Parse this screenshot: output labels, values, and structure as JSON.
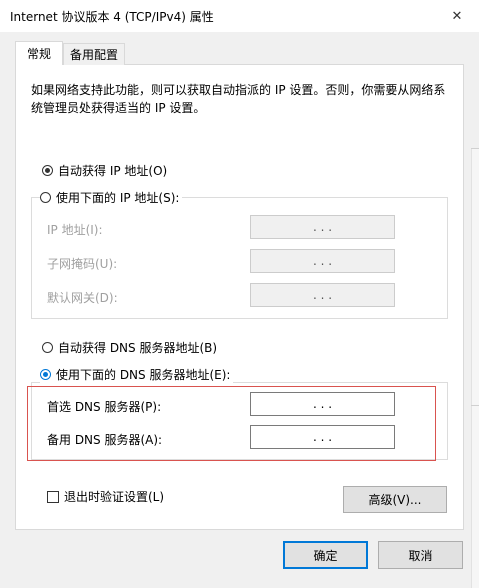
{
  "window": {
    "title": "Internet 协议版本 4 (TCP/IPv4) 属性",
    "close_glyph": "✕"
  },
  "tabs": [
    {
      "label": "常规",
      "selected": true
    },
    {
      "label": "备用配置",
      "selected": false
    }
  ],
  "description": "如果网络支持此功能，则可以获取自动指派的 IP 设置。否则，你需要从网络系统管理员处获得适当的 IP 设置。",
  "ip_section": {
    "auto_label": "自动获得 IP 地址(O)",
    "auto_selected": true,
    "manual_label": "使用下面的 IP 地址(S):",
    "manual_selected": false,
    "fields": [
      {
        "label": "IP 地址(I):",
        "value": ".   .   ."
      },
      {
        "label": "子网掩码(U):",
        "value": ".   .   ."
      },
      {
        "label": "默认网关(D):",
        "value": ".   .   ."
      }
    ]
  },
  "dns_section": {
    "auto_label": "自动获得 DNS 服务器地址(B)",
    "auto_selected": false,
    "manual_label": "使用下面的 DNS 服务器地址(E):",
    "manual_selected": true,
    "fields": [
      {
        "label": "首选 DNS 服务器(P):",
        "value": ".   .   ."
      },
      {
        "label": "备用 DNS 服务器(A):",
        "value": ".   .   ."
      }
    ]
  },
  "validate_checkbox": {
    "label": "退出时验证设置(L)",
    "checked": false
  },
  "buttons": {
    "advanced": "高级(V)...",
    "ok": "确定",
    "cancel": "取消"
  },
  "colors": {
    "accent": "#0078d7",
    "highlight_box": "#d9534f"
  }
}
